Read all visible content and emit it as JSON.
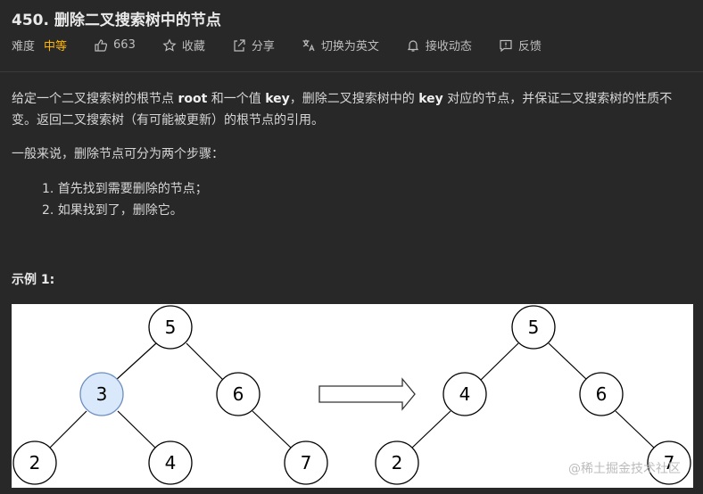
{
  "problem": {
    "title": "450. 删除二叉搜索树中的节点",
    "difficulty_label": "难度",
    "difficulty": "中等",
    "likes": "663",
    "collect_label": "收藏",
    "share_label": "分享",
    "translate_label": "切换为英文",
    "notify_label": "接收动态",
    "feedback_label": "反馈"
  },
  "description": {
    "p1_a": "给定一个二叉搜索树的根节点 ",
    "p1_b": "root",
    "p1_c": " 和一个值 ",
    "p1_d": "key",
    "p1_e": "，删除二叉搜索树中的 ",
    "p1_f": "key",
    "p1_g": " 对应的节点，并保证二叉搜索树的性质不变。返回二叉搜索树（有可能被更新）的根节点的引用。",
    "p2": "一般来说，删除节点可分为两个步骤：",
    "steps": [
      "1. 首先找到需要删除的节点；",
      "2. 如果找到了，删除它。"
    ]
  },
  "example": {
    "title": "示例 1:",
    "before_nodes": {
      "n5": "5",
      "n3": "3",
      "n6": "6",
      "n2": "2",
      "n4": "4",
      "n7": "7"
    },
    "after_nodes": {
      "n5": "5",
      "n4": "4",
      "n6": "6",
      "n2": "2",
      "n7": "7"
    },
    "highlight_color": "#dae8fc"
  },
  "watermark": "@稀土掘金技术社区",
  "colors": {
    "accent": "#ffb800",
    "background": "#282828"
  }
}
